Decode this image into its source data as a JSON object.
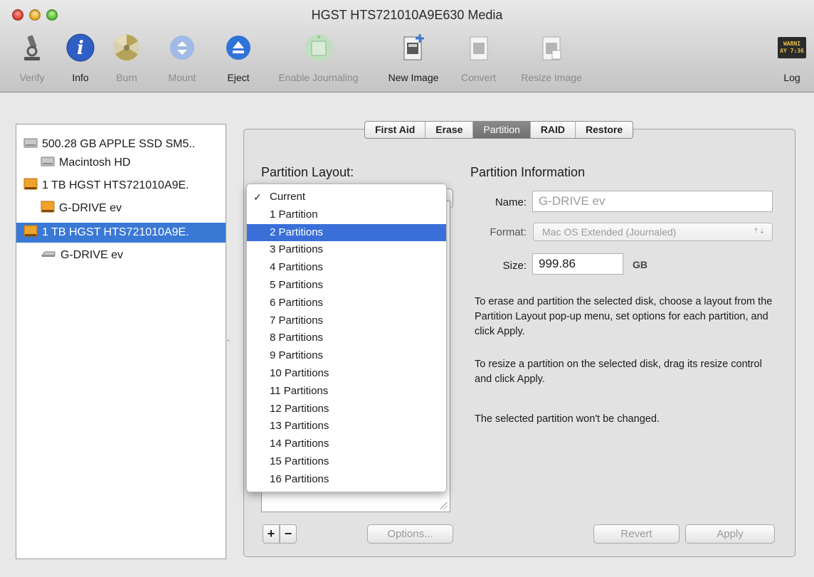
{
  "window": {
    "title": "HGST HTS721010A9E630 Media"
  },
  "toolbar": {
    "verify": "Verify",
    "info": "Info",
    "burn": "Burn",
    "mount": "Mount",
    "eject": "Eject",
    "enable_journaling": "Enable Journaling",
    "new_image": "New Image",
    "convert": "Convert",
    "resize_image": "Resize Image",
    "log": "Log",
    "log_badge_line1": "WARNI",
    "log_badge_line2": "AY 7:36"
  },
  "sidebar": {
    "items": [
      {
        "label": "500.28 GB APPLE SSD SM5..",
        "icon": "internal-disk-icon"
      },
      {
        "label": "Macintosh HD",
        "icon": "volume-icon"
      },
      {
        "label": "1 TB HGST HTS721010A9E.",
        "icon": "external-disk-icon"
      },
      {
        "label": "G-DRIVE ev",
        "icon": "volume-orange-icon"
      },
      {
        "label": "1 TB HGST HTS721010A9E.",
        "icon": "external-disk-icon",
        "selected": true
      },
      {
        "label": "G-DRIVE ev",
        "icon": "unmounted-volume-icon"
      }
    ]
  },
  "tabs": [
    "First Aid",
    "Erase",
    "Partition",
    "RAID",
    "Restore"
  ],
  "selected_tab": "Partition",
  "partition_layout": {
    "title": "Partition Layout:",
    "menu": [
      "Current",
      "1 Partition",
      "2 Partitions",
      "3 Partitions",
      "4 Partitions",
      "5 Partitions",
      "6 Partitions",
      "7 Partitions",
      "8 Partitions",
      "9 Partitions",
      "10 Partitions",
      "11 Partitions",
      "12 Partitions",
      "13 Partitions",
      "14 Partitions",
      "15 Partitions",
      "16 Partitions"
    ],
    "checked": "Current",
    "highlighted": "2 Partitions"
  },
  "partition_info": {
    "title": "Partition Information",
    "name_label": "Name:",
    "name_value": "G-DRIVE ev",
    "format_label": "Format:",
    "format_value": "Mac OS Extended (Journaled)",
    "size_label": "Size:",
    "size_value": "999.86",
    "size_unit": "GB",
    "text1": "To erase and partition the selected disk, choose a layout from the Partition Layout pop-up menu, set options for each partition, and click Apply.",
    "text2": "To resize a partition on the selected disk, drag its resize control and click Apply.",
    "text3": "The selected partition won't be changed."
  },
  "buttons": {
    "add": "+",
    "remove": "−",
    "options": "Options...",
    "revert": "Revert",
    "apply": "Apply"
  }
}
